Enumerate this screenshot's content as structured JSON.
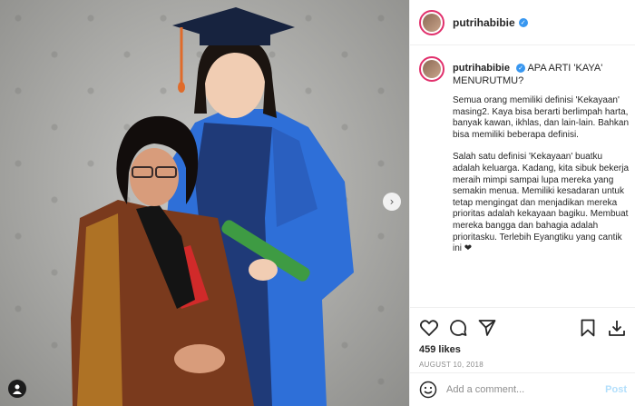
{
  "post": {
    "username": "putrihabibie",
    "caption_title": "APA ARTI 'KAYA' MENURUTMU?",
    "caption_paragraphs": [
      "Semua orang memiliki definisi 'Kekayaan' masing2. Kaya bisa berarti berlimpah harta, banyak kawan, ikhlas, dan lain-lain. Bahkan bisa memiliki beberapa definisi.",
      "Salah satu definisi 'Kekayaan' buatku adalah keluarga. Kadang, kita sibuk bekerja meraih mimpi sampai lupa mereka yang semakin menua. Memiliki kesadaran untuk tetap mengingat dan menjadikan mereka prioritas adalah kekayaan bagiku. Membuat mereka bangga dan bahagia adalah prioritasku. Terlebih Eyangtiku yang cantik ini ❤"
    ],
    "likes": "459 likes",
    "date": "AUGUST 10, 2018"
  },
  "comment": {
    "placeholder": "Add a comment...",
    "post_label": "Post"
  },
  "colors": {
    "verified": "#3897f0",
    "story_ring": "#e1306c",
    "post_disabled": "#b2dffc"
  },
  "icons": [
    "heart-icon",
    "comment-icon",
    "share-icon",
    "bookmark-icon",
    "download-icon",
    "emoji-icon",
    "next-arrow-icon",
    "user-tag-icon",
    "verified-badge-icon"
  ]
}
